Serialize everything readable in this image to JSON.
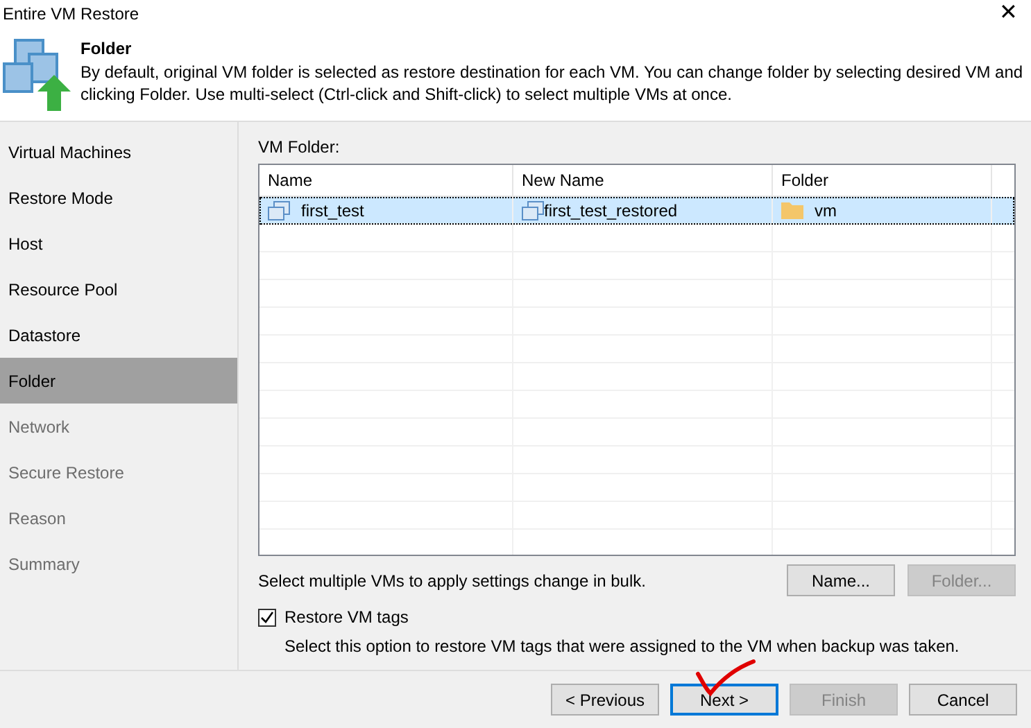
{
  "window": {
    "title": "Entire VM Restore",
    "close": "✕"
  },
  "header": {
    "title": "Folder",
    "description": "By default, original VM folder is selected as restore destination for each VM. You can change folder by selecting desired VM and clicking Folder. Use multi-select (Ctrl-click and Shift-click) to select multiple VMs at once."
  },
  "steps": [
    {
      "label": "Virtual Machines",
      "selected": false,
      "disabled": false
    },
    {
      "label": "Restore Mode",
      "selected": false,
      "disabled": false
    },
    {
      "label": "Host",
      "selected": false,
      "disabled": false
    },
    {
      "label": "Resource Pool",
      "selected": false,
      "disabled": false
    },
    {
      "label": "Datastore",
      "selected": false,
      "disabled": false
    },
    {
      "label": "Folder",
      "selected": true,
      "disabled": false
    },
    {
      "label": "Network",
      "selected": false,
      "disabled": true
    },
    {
      "label": "Secure Restore",
      "selected": false,
      "disabled": true
    },
    {
      "label": "Reason",
      "selected": false,
      "disabled": true
    },
    {
      "label": "Summary",
      "selected": false,
      "disabled": true
    }
  ],
  "grid": {
    "label": "VM Folder:",
    "columns": [
      "Name",
      "New Name",
      "Folder"
    ],
    "rows": [
      {
        "name": "first_test",
        "new_name": "first_test_restored",
        "folder": "vm",
        "selected": true
      }
    ]
  },
  "bulk": {
    "hint": "Select multiple VMs to apply settings change in bulk.",
    "buttons": [
      {
        "label": "Name...",
        "disabled": false
      },
      {
        "label": "Folder...",
        "disabled": true
      }
    ]
  },
  "restore_tags": {
    "label": "Restore VM tags",
    "checked": true,
    "hint": "Select this option to restore VM tags that were assigned to the VM when backup was taken."
  },
  "nav_buttons": [
    {
      "label": "< Previous",
      "disabled": false,
      "focused": false
    },
    {
      "label": "Next >",
      "disabled": false,
      "focused": true
    },
    {
      "label": "Finish",
      "disabled": true,
      "focused": false
    },
    {
      "label": "Cancel",
      "disabled": false,
      "focused": false
    }
  ]
}
